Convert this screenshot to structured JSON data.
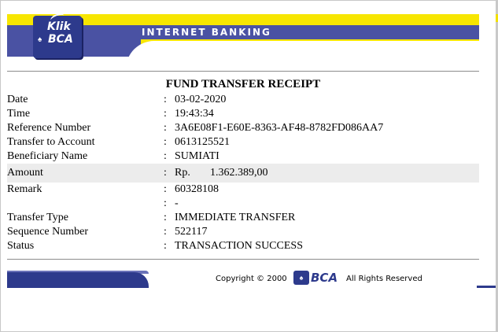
{
  "header": {
    "title": "INTERNET BANKING",
    "logo_klik": "Klik",
    "logo_bca": "BCA"
  },
  "receipt": {
    "title": "FUND TRANSFER RECEIPT",
    "rows": [
      {
        "label": "Date",
        "sep": ":",
        "value": "03-02-2020"
      },
      {
        "label": "Time",
        "sep": ":",
        "value": "19:43:34"
      },
      {
        "label": "Reference Number",
        "sep": ":",
        "value": "3A6E08F1-E60E-8363-AF48-8782FD086AA7"
      },
      {
        "label": "Transfer to Account",
        "sep": ":",
        "value": "0613125521"
      },
      {
        "label": "Beneficiary Name",
        "sep": ":",
        "value": "SUMIATI"
      },
      {
        "label": "Amount",
        "sep": ":",
        "currency": "Rp.",
        "value": "1.362.389,00"
      },
      {
        "label": "Remark",
        "sep": ":",
        "value": "60328108"
      },
      {
        "label": "",
        "sep": ":",
        "value": "-"
      },
      {
        "label": "Transfer Type",
        "sep": ":",
        "value": "IMMEDIATE TRANSFER"
      },
      {
        "label": "Sequence Number",
        "sep": ":",
        "value": "522117"
      },
      {
        "label": "Status",
        "sep": ":",
        "value": "TRANSACTION SUCCESS"
      }
    ]
  },
  "footer": {
    "copyright": "Copyright © 2000",
    "brand": "BCA",
    "rights": "All Rights Reserved"
  },
  "colors": {
    "brand_blue": "#2d3a8c",
    "header_blue": "#4a52a3",
    "header_yellow": "#f7e600",
    "row_shade": "#ececec"
  }
}
